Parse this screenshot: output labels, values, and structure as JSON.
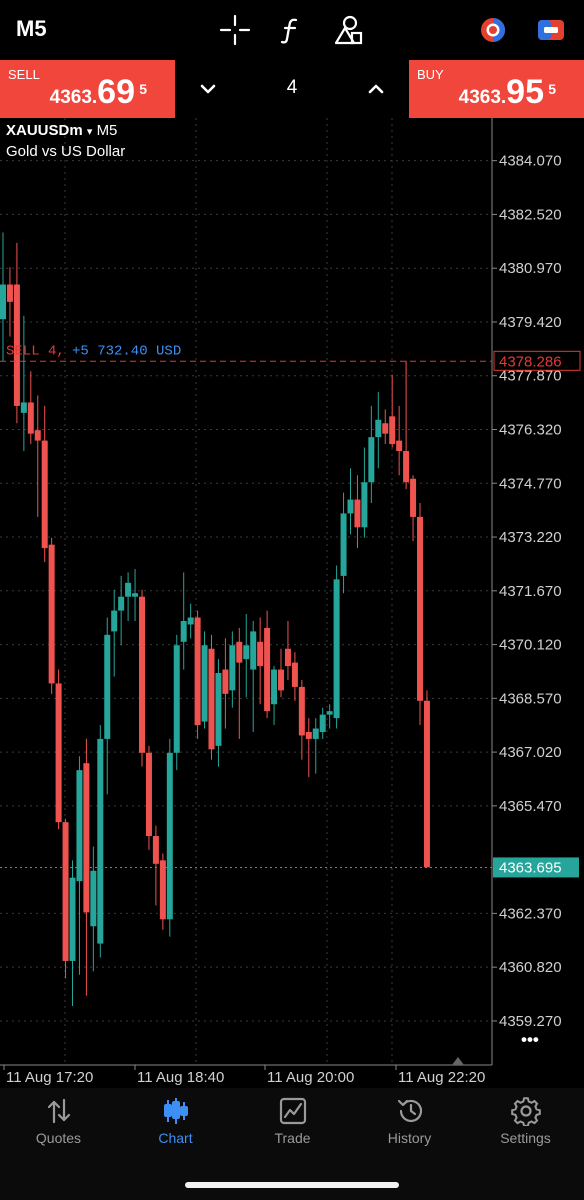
{
  "toolbar": {
    "timeframe": "M5",
    "icons": [
      "crosshair-icon",
      "function-icon",
      "objects-icon",
      "account-switch-icon",
      "one-click-trading-icon"
    ]
  },
  "trade_panel": {
    "sell": {
      "label": "SELL",
      "price_prefix": "4363.",
      "price_big": "69",
      "price_sup": "5"
    },
    "volume": "4",
    "buy": {
      "label": "BUY",
      "price_prefix": "4363.",
      "price_big": "95",
      "price_sup": "5"
    }
  },
  "symbol": {
    "name": "XAUUSDm",
    "caret": "▾",
    "timeframe": "M5",
    "description": "Gold vs US Dollar"
  },
  "position_line": {
    "label": "SELL 4,",
    "profit": "+5 732.40 USD",
    "price_tag": "4378.286"
  },
  "current_price_tag": "4363.695",
  "more_label": "•••",
  "colors": {
    "bull": "#26a69a",
    "bear": "#ef5350",
    "sell_button": "#f0463c",
    "active_nav": "#3d8ef5",
    "grid": "#3a3a3a"
  },
  "chart_data": {
    "type": "candlestick",
    "symbol": "XAUUSDm",
    "timeframe": "M5",
    "y_ticks": [
      "4384.070",
      "4382.520",
      "4380.970",
      "4379.420",
      "4377.870",
      "4376.320",
      "4374.770",
      "4373.220",
      "4371.670",
      "4370.120",
      "4368.570",
      "4367.020",
      "4365.470",
      "4362.370",
      "4360.820",
      "4359.270"
    ],
    "y_range": [
      4358.0,
      4385.3
    ],
    "x_ticks": [
      "11 Aug 17:20",
      "11 Aug 18:40",
      "11 Aug 20:00",
      "11 Aug 22:20"
    ],
    "position_price": 4378.286,
    "current_price": 4363.695,
    "candles": [
      {
        "o": 4379.5,
        "h": 4382.0,
        "l": 4378.3,
        "c": 4380.5
      },
      {
        "o": 4380.5,
        "h": 4381.0,
        "l": 4379.0,
        "c": 4380.0
      },
      {
        "o": 4380.5,
        "h": 4381.7,
        "l": 4376.5,
        "c": 4377.0
      },
      {
        "o": 4376.8,
        "h": 4379.6,
        "l": 4375.7,
        "c": 4377.1
      },
      {
        "o": 4377.1,
        "h": 4378.0,
        "l": 4375.9,
        "c": 4376.2
      },
      {
        "o": 4376.3,
        "h": 4377.3,
        "l": 4373.8,
        "c": 4376.0
      },
      {
        "o": 4376.0,
        "h": 4377.0,
        "l": 4372.5,
        "c": 4372.9
      },
      {
        "o": 4373.0,
        "h": 4373.2,
        "l": 4368.7,
        "c": 4369.0
      },
      {
        "o": 4369.0,
        "h": 4369.4,
        "l": 4364.8,
        "c": 4365.0
      },
      {
        "o": 4365.0,
        "h": 4365.1,
        "l": 4360.5,
        "c": 4361.0
      },
      {
        "o": 4361.0,
        "h": 4363.9,
        "l": 4359.7,
        "c": 4363.4
      },
      {
        "o": 4363.3,
        "h": 4366.9,
        "l": 4360.6,
        "c": 4366.5
      },
      {
        "o": 4366.7,
        "h": 4367.4,
        "l": 4360.0,
        "c": 4362.4
      },
      {
        "o": 4362.0,
        "h": 4364.3,
        "l": 4360.7,
        "c": 4363.6
      },
      {
        "o": 4361.5,
        "h": 4367.8,
        "l": 4361.1,
        "c": 4367.4
      },
      {
        "o": 4367.4,
        "h": 4370.9,
        "l": 4365.8,
        "c": 4370.4
      },
      {
        "o": 4370.5,
        "h": 4371.7,
        "l": 4369.2,
        "c": 4371.1
      },
      {
        "o": 4371.1,
        "h": 4372.1,
        "l": 4370.1,
        "c": 4371.5
      },
      {
        "o": 4371.5,
        "h": 4372.2,
        "l": 4370.8,
        "c": 4371.9
      },
      {
        "o": 4371.5,
        "h": 4372.3,
        "l": 4370.8,
        "c": 4371.6
      },
      {
        "o": 4371.5,
        "h": 4371.7,
        "l": 4366.6,
        "c": 4367.0
      },
      {
        "o": 4367.0,
        "h": 4367.2,
        "l": 4364.2,
        "c": 4364.6
      },
      {
        "o": 4364.6,
        "h": 4364.9,
        "l": 4362.6,
        "c": 4363.8
      },
      {
        "o": 4363.9,
        "h": 4364.1,
        "l": 4361.9,
        "c": 4362.2
      },
      {
        "o": 4362.2,
        "h": 4367.4,
        "l": 4361.7,
        "c": 4367.0
      },
      {
        "o": 4367.0,
        "h": 4370.4,
        "l": 4366.5,
        "c": 4370.1
      },
      {
        "o": 4370.2,
        "h": 4372.2,
        "l": 4369.4,
        "c": 4370.8
      },
      {
        "o": 4370.7,
        "h": 4371.3,
        "l": 4370.3,
        "c": 4370.9
      },
      {
        "o": 4370.9,
        "h": 4371.1,
        "l": 4367.4,
        "c": 4367.8
      },
      {
        "o": 4367.9,
        "h": 4370.5,
        "l": 4367.7,
        "c": 4370.1
      },
      {
        "o": 4370.0,
        "h": 4370.4,
        "l": 4366.8,
        "c": 4367.1
      },
      {
        "o": 4367.2,
        "h": 4369.7,
        "l": 4366.6,
        "c": 4369.3
      },
      {
        "o": 4369.4,
        "h": 4370.3,
        "l": 4367.7,
        "c": 4368.7
      },
      {
        "o": 4368.8,
        "h": 4370.5,
        "l": 4368.3,
        "c": 4370.1
      },
      {
        "o": 4370.2,
        "h": 4370.6,
        "l": 4367.4,
        "c": 4369.6
      },
      {
        "o": 4369.7,
        "h": 4371.0,
        "l": 4368.6,
        "c": 4370.1
      },
      {
        "o": 4369.4,
        "h": 4370.8,
        "l": 4367.6,
        "c": 4370.5
      },
      {
        "o": 4370.2,
        "h": 4370.9,
        "l": 4368.4,
        "c": 4369.5
      },
      {
        "o": 4370.6,
        "h": 4371.1,
        "l": 4368.0,
        "c": 4368.2
      },
      {
        "o": 4368.4,
        "h": 4369.5,
        "l": 4367.8,
        "c": 4369.4
      },
      {
        "o": 4369.4,
        "h": 4370.0,
        "l": 4368.6,
        "c": 4368.8
      },
      {
        "o": 4370.0,
        "h": 4370.8,
        "l": 4369.1,
        "c": 4369.5
      },
      {
        "o": 4369.6,
        "h": 4369.9,
        "l": 4368.5,
        "c": 4368.9
      },
      {
        "o": 4368.9,
        "h": 4369.1,
        "l": 4366.8,
        "c": 4367.5
      },
      {
        "o": 4367.6,
        "h": 4368.0,
        "l": 4366.3,
        "c": 4367.4
      },
      {
        "o": 4367.4,
        "h": 4368.0,
        "l": 4366.4,
        "c": 4367.7
      },
      {
        "o": 4367.6,
        "h": 4368.3,
        "l": 4367.4,
        "c": 4368.1
      },
      {
        "o": 4368.1,
        "h": 4368.4,
        "l": 4367.7,
        "c": 4368.2
      },
      {
        "o": 4368.0,
        "h": 4372.4,
        "l": 4367.7,
        "c": 4372.0
      },
      {
        "o": 4372.1,
        "h": 4374.5,
        "l": 4371.6,
        "c": 4373.9
      },
      {
        "o": 4373.9,
        "h": 4375.2,
        "l": 4373.3,
        "c": 4374.3
      },
      {
        "o": 4374.3,
        "h": 4375.0,
        "l": 4372.9,
        "c": 4373.5
      },
      {
        "o": 4373.5,
        "h": 4375.8,
        "l": 4373.2,
        "c": 4374.8
      },
      {
        "o": 4374.8,
        "h": 4377.0,
        "l": 4374.2,
        "c": 4376.1
      },
      {
        "o": 4376.1,
        "h": 4377.4,
        "l": 4375.2,
        "c": 4376.6
      },
      {
        "o": 4376.5,
        "h": 4376.9,
        "l": 4375.9,
        "c": 4376.2
      },
      {
        "o": 4376.7,
        "h": 4377.9,
        "l": 4375.8,
        "c": 4375.9
      },
      {
        "o": 4376.0,
        "h": 4377.0,
        "l": 4375.0,
        "c": 4375.7
      },
      {
        "o": 4375.7,
        "h": 4378.3,
        "l": 4374.6,
        "c": 4374.8
      },
      {
        "o": 4374.9,
        "h": 4375.0,
        "l": 4373.1,
        "c": 4373.8
      },
      {
        "o": 4373.8,
        "h": 4374.2,
        "l": 4367.8,
        "c": 4368.5
      },
      {
        "o": 4368.5,
        "h": 4368.8,
        "l": 4363.7,
        "c": 4363.7
      }
    ]
  },
  "nav": [
    {
      "label": "Quotes",
      "icon": "quotes-icon"
    },
    {
      "label": "Chart",
      "icon": "chart-icon"
    },
    {
      "label": "Trade",
      "icon": "trade-icon"
    },
    {
      "label": "History",
      "icon": "history-icon"
    },
    {
      "label": "Settings",
      "icon": "settings-icon"
    }
  ]
}
